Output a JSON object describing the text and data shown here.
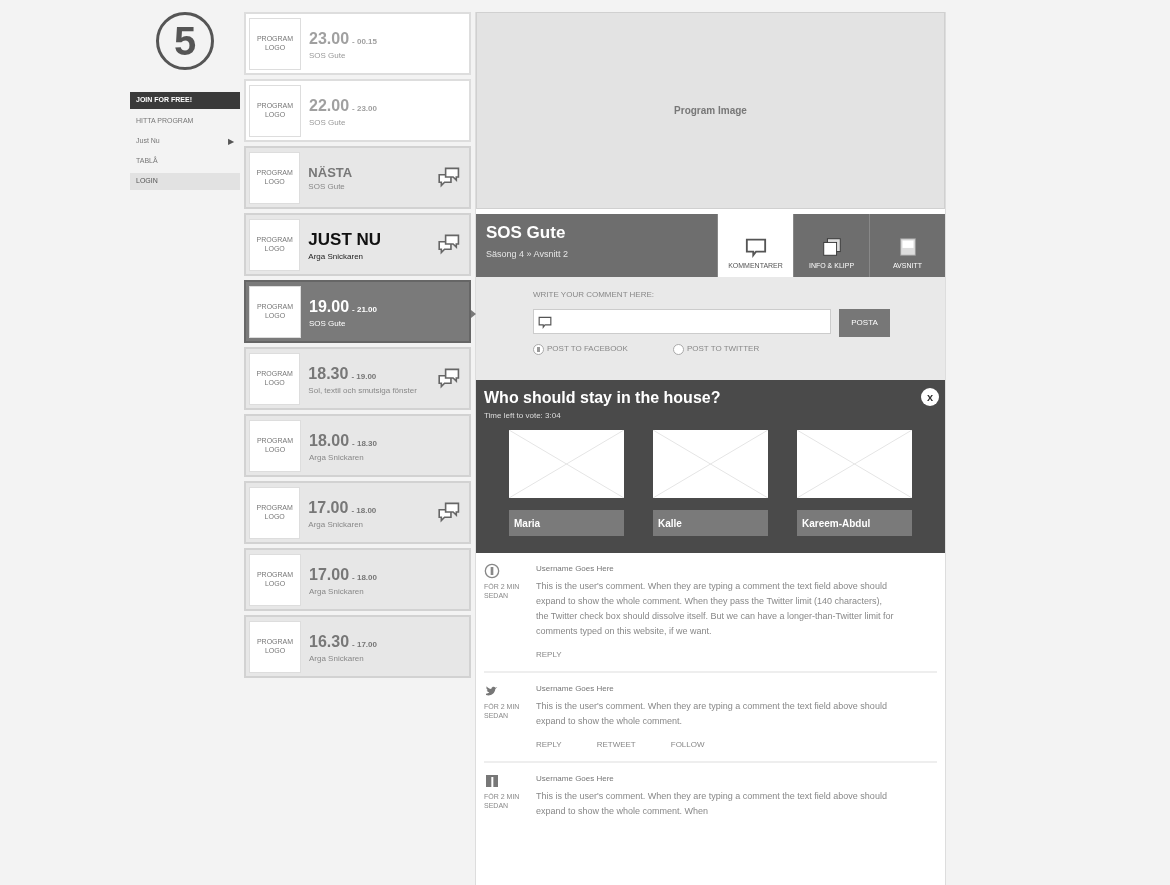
{
  "logo": {
    "text": "5"
  },
  "sidebar": {
    "items": [
      {
        "label": "JOIN FOR FREE!",
        "kind": "cta",
        "selected": false
      },
      {
        "label": "HITTA PROGRAM",
        "kind": "link",
        "selected": false
      },
      {
        "label": "Just Nu",
        "kind": "link",
        "selected": false,
        "arrow": "▶"
      },
      {
        "label": "TABLÅ",
        "kind": "link",
        "selected": false
      },
      {
        "label": "LOGIN",
        "kind": "link",
        "selected": true
      }
    ]
  },
  "schedule": [
    {
      "logo": "PROGRAM LOGO",
      "kind": "past",
      "time": "23.00",
      "end": "- 00.15",
      "title": "SOS Gute",
      "selected": false,
      "comments": false
    },
    {
      "logo": "PROGRAM LOGO",
      "kind": "past",
      "time": "22.00",
      "end": "- 23.00",
      "title": "SOS Gute",
      "selected": false,
      "comments": false
    },
    {
      "logo": "PROGRAM LOGO",
      "kind": "next",
      "time": "NÄSTA",
      "title": "SOS Gute",
      "selected": false,
      "comments": true
    },
    {
      "logo": "PROGRAM LOGO",
      "kind": "now",
      "time": "JUST NU",
      "title": "Arga Snickaren",
      "selected": false,
      "comments": true
    },
    {
      "logo": "PROGRAM LOGO",
      "kind": "regular",
      "time": "19.00",
      "end": "- 21.00",
      "title": "SOS Gute",
      "selected": true,
      "comments": false
    },
    {
      "logo": "PROGRAM LOGO",
      "kind": "regular",
      "time": "18.30",
      "end": "- 19.00",
      "title": "Sol, textil och smutsiga fönster",
      "selected": false,
      "comments": true
    },
    {
      "logo": "PROGRAM LOGO",
      "kind": "regular",
      "time": "18.00",
      "end": "- 18.30",
      "title": "Arga Snickaren",
      "selected": false,
      "comments": false
    },
    {
      "logo": "PROGRAM LOGO",
      "kind": "regular",
      "time": "17.00",
      "end": "- 18.00",
      "title": "Arga Snickaren",
      "selected": false,
      "comments": true
    },
    {
      "logo": "PROGRAM LOGO",
      "kind": "regular",
      "time": "17.00",
      "end": "- 18.00",
      "title": "Arga Snickaren",
      "selected": false,
      "comments": false
    },
    {
      "logo": "PROGRAM LOGO",
      "kind": "regular",
      "time": "16.30",
      "end": "- 17.00",
      "title": "Arga Snickaren",
      "selected": false,
      "comments": false
    }
  ],
  "program_image": {
    "label": "Program Image"
  },
  "program": {
    "title": "SOS Gute",
    "subtitle": "Säsong 4 » Avsnitt 2"
  },
  "tabs": [
    {
      "label": "KOMMENTARER",
      "selected": true
    },
    {
      "label": "INFO & KLIPP",
      "selected": false
    },
    {
      "label": "AVSNITT",
      "selected": false
    }
  ],
  "comment_form": {
    "label": "WRITE YOUR COMMENT HERE:",
    "button": "POSTA",
    "options": [
      {
        "label": "POST TO FACEBOOK",
        "checked": true
      },
      {
        "label": "POST TO TWITTER",
        "checked": false
      }
    ]
  },
  "poll": {
    "question": "Who should stay in the house?",
    "timer": "Time left to vote: 3:04",
    "close": "x",
    "candidates": [
      {
        "name": "Maria"
      },
      {
        "name": "Kalle"
      },
      {
        "name": "Kareem-Abdul"
      }
    ]
  },
  "comments": [
    {
      "kind": "site",
      "user": "Username Goes Here",
      "time": "FÖR 2 MIN SEDAN",
      "text": "This is the user's comment. When they are typing a comment the text field above should expand to show the whole comment. When they pass the Twitter limit (140 characters), the Twitter check box should dissolve itself. But we can have a longer-than-Twitter limit for comments typed on this website, if we want.",
      "actions": [
        "REPLY"
      ]
    },
    {
      "kind": "twitter",
      "user": "Username Goes Here",
      "time": "FÖR 2 MIN SEDAN",
      "text": "This is the user's comment. When they are typing a comment the text field above should expand to show the whole comment.",
      "actions": [
        "REPLY",
        "RETWEET",
        "FOLLOW"
      ]
    },
    {
      "kind": "facebook",
      "user": "Username Goes Here",
      "time": "FÖR 2 MIN SEDAN",
      "text": "This is the user's comment. When they are typing a comment the text field above should expand to show the whole comment. When"
    }
  ]
}
